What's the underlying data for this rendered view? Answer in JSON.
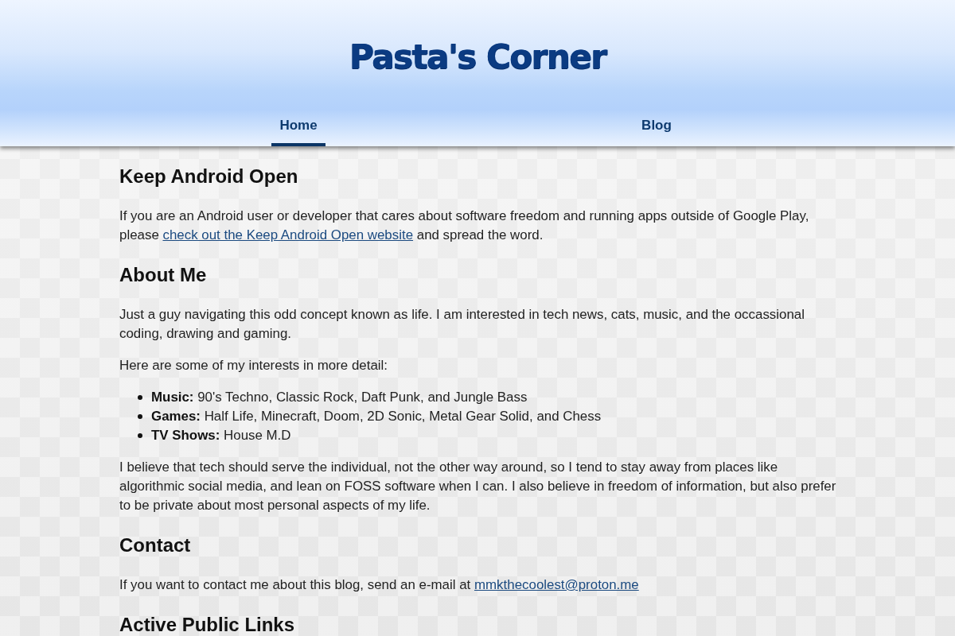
{
  "site": {
    "title": "Pasta's Corner"
  },
  "nav": [
    {
      "label": "Home",
      "selected": true
    },
    {
      "label": "Blog",
      "selected": false
    }
  ],
  "sections": [
    {
      "heading": "Keep Android Open",
      "blocks": [
        {
          "kind": "paragraph",
          "parts": [
            {
              "kind": "text",
              "text": "If you are an Android user or developer that cares about software freedom and running apps outside of Google Play, please "
            },
            {
              "kind": "link",
              "text": "check out the Keep Android Open website"
            },
            {
              "kind": "text",
              "text": " and spread the word."
            }
          ]
        }
      ]
    },
    {
      "heading": "About Me",
      "blocks": [
        {
          "kind": "paragraph",
          "parts": [
            {
              "kind": "text",
              "text": "Just a guy navigating this odd concept known as life. I am interested in tech news, cats, music, and the occassional coding, drawing and gaming."
            }
          ]
        },
        {
          "kind": "paragraph",
          "parts": [
            {
              "kind": "text",
              "text": "Here are some of my interests in more detail:"
            }
          ]
        },
        {
          "kind": "list",
          "items": [
            "**Music:** 90's Techno, Classic Rock, Daft Punk, and Jungle Bass",
            "**Games:** Half Life, Minecraft, Doom, 2D Sonic, Metal Gear Solid, and Chess",
            "**TV Shows:** House M.D"
          ]
        },
        {
          "kind": "paragraph",
          "parts": [
            {
              "kind": "text",
              "text": "I believe that tech should serve the individual, not the other way around, so I tend to stay away from places like algorithmic social media, and lean on FOSS software when I can. I also believe in freedom of information, but also prefer to be private about most personal aspects of my life."
            }
          ]
        }
      ]
    },
    {
      "heading": "Contact",
      "blocks": [
        {
          "kind": "paragraph",
          "parts": [
            {
              "kind": "text",
              "text": "If you want to contact me about this blog, send an e-mail at "
            },
            {
              "kind": "link",
              "text": "mmkthecoolest@proton.me"
            }
          ]
        }
      ]
    },
    {
      "heading": "Active Public Links"
    }
  ]
}
